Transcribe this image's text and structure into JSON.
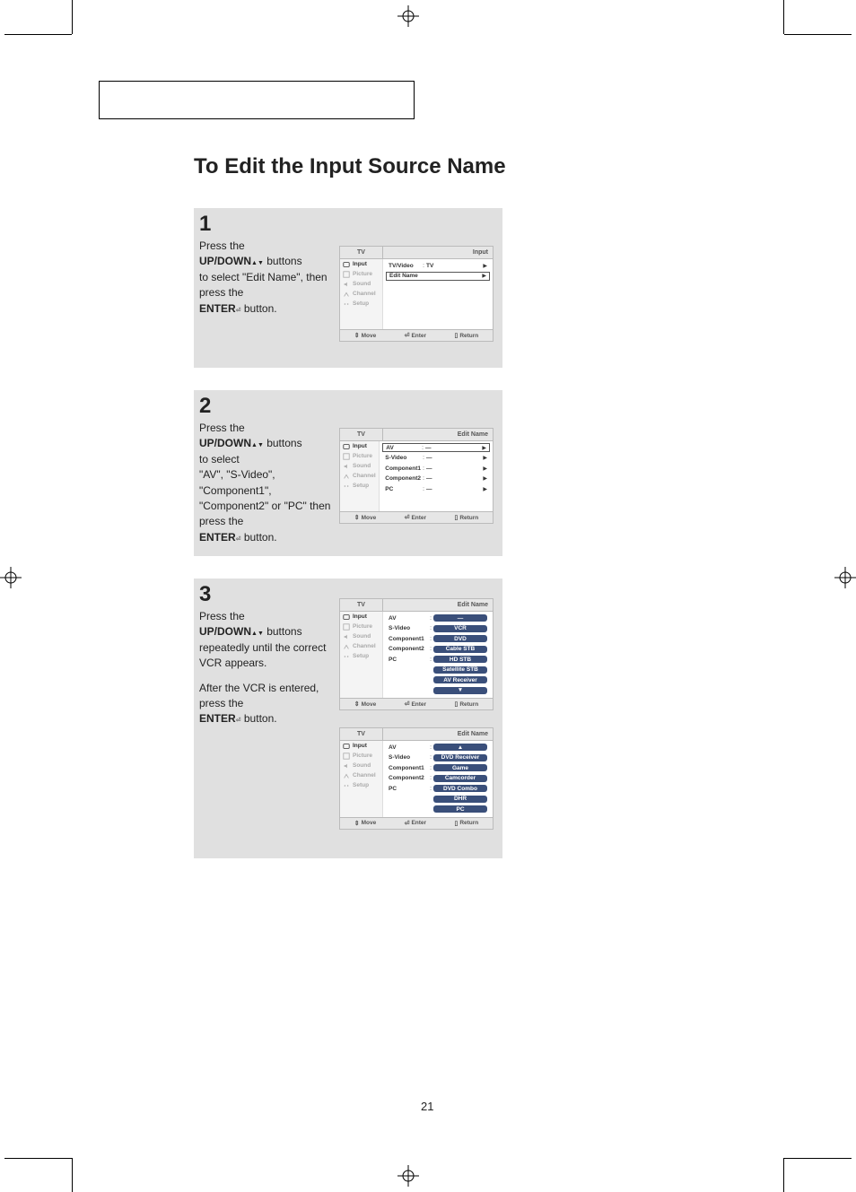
{
  "title": "To Edit the Input Source Name",
  "page_number": "21",
  "steps": {
    "s1": {
      "num": "1",
      "p1a": "Press the",
      "p1b": "UP/DOWN",
      "p1c": " buttons",
      "p1d": "to select \"Edit Name\", then press the",
      "p1e": "ENTER",
      "p1f": " button."
    },
    "s2": {
      "num": "2",
      "p1a": "Press the",
      "p1b": "UP/DOWN",
      "p1c": " buttons",
      "p1d": "to select",
      "p1e": "\"AV\", \"S-Video\", \"Component1\", \"Component2\" or \"PC\" then press the",
      "p1f": "ENTER",
      "p1g": " button."
    },
    "s3": {
      "num": "3",
      "p1a": "Press the",
      "p1b": "UP/DOWN",
      "p1c": " buttons",
      "p1d": "repeatedly until the correct VCR appears.",
      "p2a": "After the VCR is entered, press the",
      "p2b": "ENTER",
      "p2c": " button."
    }
  },
  "osd": {
    "tv_label": "TV",
    "side": {
      "input": "Input",
      "picture": "Picture",
      "sound": "Sound",
      "channel": "Channel",
      "setup": "Setup"
    },
    "foot": {
      "move": "Move",
      "enter": "Enter",
      "return": "Return"
    },
    "panel1": {
      "breadcrumb": "Input",
      "rows": {
        "r1_label": "TV/Video",
        "r1_value": "TV",
        "r2_label": "Edit Name"
      }
    },
    "panel2": {
      "breadcrumb": "Edit Name",
      "rows": {
        "r1": "AV",
        "r1v": "—",
        "r2": "S-Video",
        "r2v": "—",
        "r3": "Component1",
        "r3v": "—",
        "r4": "Component2",
        "r4v": "—",
        "r5": "PC",
        "r5v": "—"
      }
    },
    "panel3": {
      "breadcrumb": "Edit Name",
      "rows": {
        "r1": "AV",
        "r2": "S-Video",
        "r3": "Component1",
        "r4": "Component2",
        "r5": "PC"
      },
      "opts": {
        "o1": "—",
        "o2": "VCR",
        "o3": "DVD",
        "o4": "Cable STB",
        "o5": "HD STB",
        "o6": "Satellite STB",
        "o7": "AV Receiver"
      }
    },
    "panel4": {
      "breadcrumb": "Edit Name",
      "rows": {
        "r1": "AV",
        "r2": "S-Video",
        "r3": "Component1",
        "r4": "Component2",
        "r5": "PC"
      },
      "opts": {
        "o1": "DVD Receiver",
        "o2": "Game",
        "o3": "Camcorder",
        "o4": "DVD Combo",
        "o5": "DHR",
        "o6": "PC"
      }
    }
  }
}
